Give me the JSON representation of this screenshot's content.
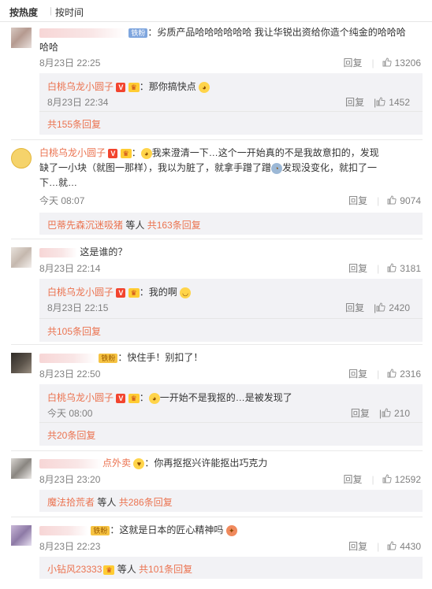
{
  "sort": {
    "hot": "按热度",
    "time": "按时间"
  },
  "icons": {
    "like": "thumbs-up-icon",
    "emoji": "face-emoji-icon"
  },
  "colors": {
    "accent_name": "#eb7350",
    "meta": "#808080",
    "reply_bg": "#f2f2f5"
  },
  "labels": {
    "reply": "回复"
  },
  "comments": [
    {
      "badge": "铁粉",
      "text": "：劣质产品哈哈哈哈哈哈  我让华锐出资给你造个纯金的哈哈哈",
      "text2": "哈哈",
      "time": "8月23日 22:25",
      "likes": "13206",
      "reply": {
        "name": "白桃乌龙小圆子",
        "text": "：那你搞快点",
        "time": "8月23日 22:34",
        "likes": "1452"
      },
      "more": "共155条回复"
    },
    {
      "name": "白桃乌龙小圆子",
      "text": "我来澄清一下…这个一开始真的不是我故意扣的，发现",
      "text2": "缺了一小块（就图一那样），我以为脏了，就拿手蹭了蹭",
      "text2b": "发现没变化，就扣了一",
      "text3": "下…就…",
      "time": "今天 08:07",
      "likes": "9074",
      "more_name": "巴蒂先森沉迷吸猪",
      "more_mid": " 等人 ",
      "more": "共163条回复"
    },
    {
      "text": "这是谁的？",
      "time": "8月23日 22:14",
      "likes": "3181",
      "reply": {
        "name": "白桃乌龙小圆子",
        "text": "：我的啊",
        "time": "8月23日 22:15",
        "likes": "2420"
      },
      "more": "共105条回复"
    },
    {
      "badge": "铁粉",
      "text": "：快住手！别扣了！",
      "time": "8月23日 22:50",
      "likes": "2316",
      "reply": {
        "name": "白桃乌龙小圆子",
        "text": "一开始不是我抠的…是被发现了",
        "time": "今天 08:00",
        "likes": "210"
      },
      "more": "共20条回复"
    },
    {
      "name_tail": "点外卖",
      "text": "：你再抠抠兴许能抠出巧克力",
      "time": "8月23日 23:20",
      "likes": "12592",
      "more_name": "魔法拾荒者",
      "more_mid": " 等人 ",
      "more": "共286条回复"
    },
    {
      "badge": "铁粉",
      "text": "：这就是日本的匠心精神吗",
      "time": "8月23日 22:23",
      "likes": "4430",
      "more_name": "小钻风23333",
      "more_mid": " 等人 ",
      "more": "共101条回复"
    }
  ]
}
